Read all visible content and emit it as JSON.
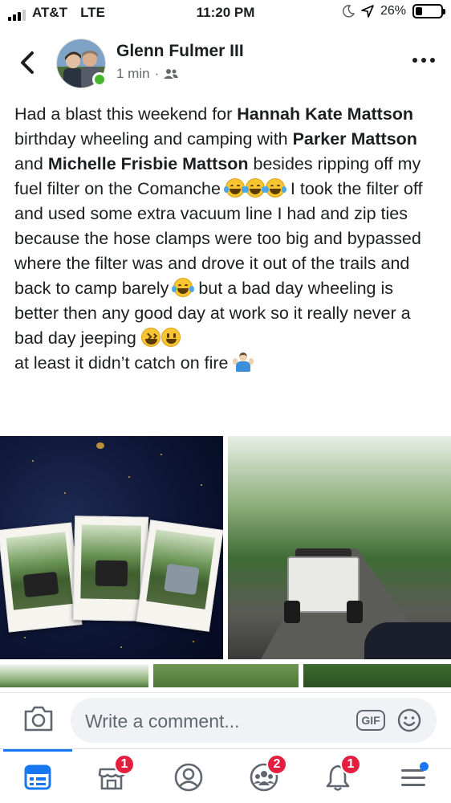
{
  "status_bar": {
    "carrier": "AT&T",
    "network": "LTE",
    "time": "11:20 PM",
    "battery": "26%",
    "battery_level": 0.26
  },
  "post": {
    "author": "Glenn Fulmer III",
    "time": "1 min",
    "separator": "·",
    "privacy_icon": "friends-icon",
    "text": {
      "p1": "Had a blast this weekend for ",
      "tag1": "Hannah Kate Mattson",
      "p2": " birthday wheeling and camping with ",
      "tag2": "Parker Mattson",
      "p3": " and ",
      "tag3": "Michelle Frisbie Mattson",
      "p4": " besides ripping off my fuel filter on the Comanche ",
      "p5": " I took the filter off and used some extra vacuum line I had and zip ties because the hose clamps were too big and bypassed where the filter was and drove it out of the trails and back to camp barely ",
      "p6": " but a bad day wheeling is better then any good day at work so it really never a bad day jeeping ",
      "p7": " at least it didn’t catch on fire "
    },
    "photo_count": 5
  },
  "comment": {
    "placeholder": "Write a comment...",
    "gif_label": "GIF"
  },
  "tabs": [
    {
      "name": "news-feed",
      "icon": "news-feed-icon",
      "badge": ""
    },
    {
      "name": "marketplace",
      "icon": "marketplace-icon",
      "badge": "1"
    },
    {
      "name": "profile",
      "icon": "profile-icon",
      "badge": ""
    },
    {
      "name": "groups",
      "icon": "groups-icon",
      "badge": "2"
    },
    {
      "name": "notifications",
      "icon": "bell-icon",
      "badge": "1"
    },
    {
      "name": "menu",
      "icon": "menu-icon",
      "badge": ""
    }
  ],
  "colors": {
    "accent": "#1877f2",
    "badge": "#e41e3f",
    "online": "#42b72a"
  }
}
